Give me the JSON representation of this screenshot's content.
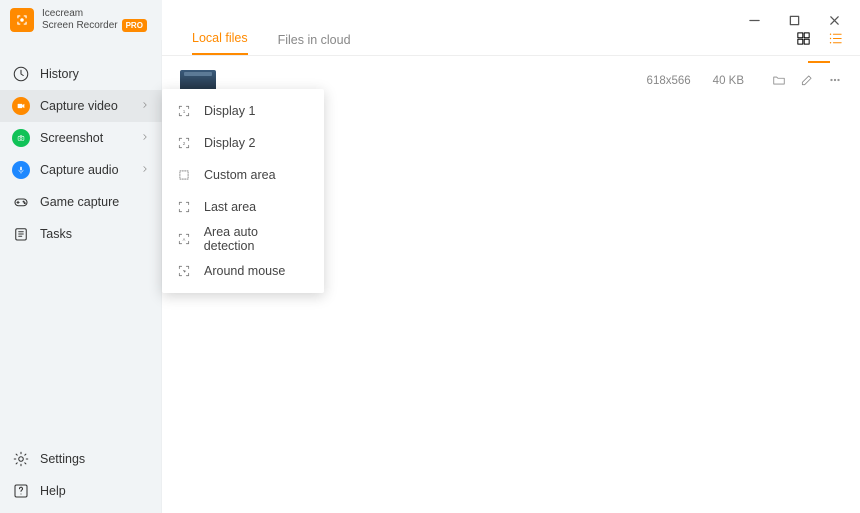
{
  "app": {
    "name_line1": "Icecream",
    "name_line2": "Screen Recorder",
    "badge": "PRO"
  },
  "sidebar": {
    "items": [
      {
        "label": "History"
      },
      {
        "label": "Capture video"
      },
      {
        "label": "Screenshot"
      },
      {
        "label": "Capture audio"
      },
      {
        "label": "Game capture"
      },
      {
        "label": "Tasks"
      }
    ],
    "bottom": [
      {
        "label": "Settings"
      },
      {
        "label": "Help"
      }
    ]
  },
  "tabs": {
    "local": "Local files",
    "cloud": "Files in cloud"
  },
  "file": {
    "dimensions": "618x566",
    "size": "40 KB"
  },
  "capture_menu": {
    "items": [
      "Display 1",
      "Display 2",
      "Custom area",
      "Last area",
      "Area auto detection",
      "Around mouse"
    ]
  }
}
